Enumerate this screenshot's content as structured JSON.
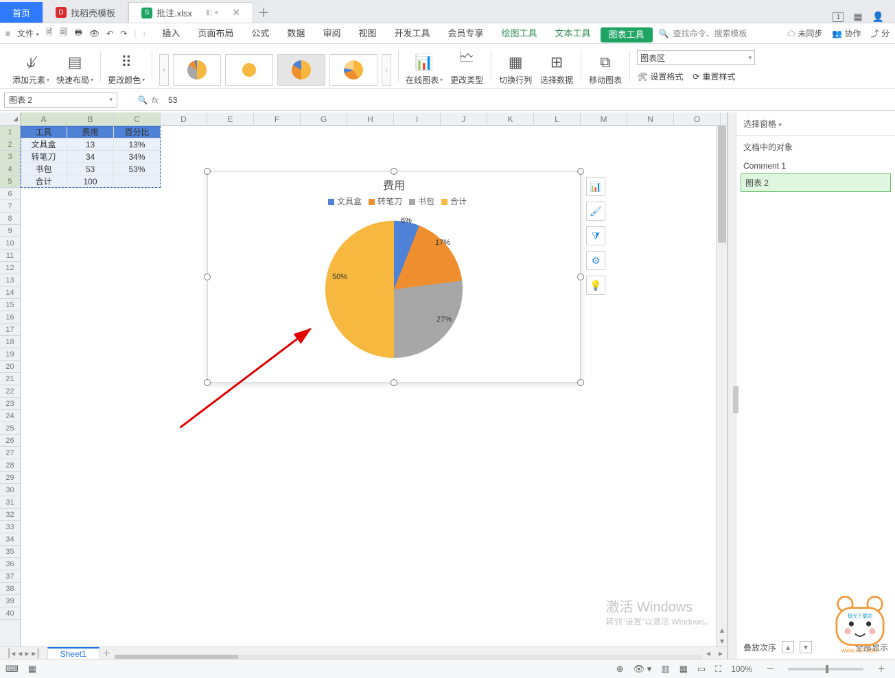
{
  "tabs": {
    "home": "首页",
    "docai": "找稻壳模板",
    "file": "批注.xlsx"
  },
  "titlebar_right": {
    "badge": "1"
  },
  "ribbon": {
    "file_menu": "文件",
    "insert": "插入",
    "page_layout": "页面布局",
    "formula": "公式",
    "data": "数据",
    "review": "审阅",
    "view": "视图",
    "dev": "开发工具",
    "vip": "会员专享",
    "draw": "绘图工具",
    "text": "文本工具",
    "chart": "图表工具",
    "search_placeholder": "查找命令、搜索模板",
    "unsync": "未同步",
    "coop": "协作",
    "share": "分"
  },
  "tools": {
    "add_element": "添加元素",
    "quick_layout": "快速布局",
    "change_color": "更改颜色",
    "online_chart": "在线图表",
    "change_type": "更改类型",
    "switch_rc": "切换行列",
    "select_data": "选择数据",
    "move_chart": "移动图表",
    "area_combo": "图表区",
    "set_fmt": "设置格式",
    "reset_style": "重置样式"
  },
  "fx": {
    "name_box": "图表 2",
    "formula": "53"
  },
  "table": {
    "headers": [
      "工具",
      "费用",
      "百分比"
    ],
    "rows": [
      {
        "a": "文具盒",
        "b": "13",
        "c": "13%"
      },
      {
        "a": "转笔刀",
        "b": "34",
        "c": "34%"
      },
      {
        "a": "书包",
        "b": "53",
        "c": "53%"
      },
      {
        "a": "合计",
        "b": "100",
        "c": ""
      }
    ]
  },
  "chart_data": {
    "type": "pie",
    "title": "费用",
    "legend": [
      "文具盒",
      "转笔刀",
      "书包",
      "合计"
    ],
    "categories": [
      "文具盒",
      "转笔刀",
      "书包",
      "合计"
    ],
    "values": [
      6,
      17,
      27,
      50
    ],
    "value_suffix": "%",
    "colors": {
      "文具盒": "#4f81d6",
      "转笔刀": "#ef8e2f",
      "书包": "#a7a7a7",
      "合计": "#f6b83e"
    }
  },
  "side": {
    "title": "选择窗格",
    "subtitle": "文档中的对象",
    "items": [
      "Comment 1",
      "图表 2"
    ],
    "selected_index": 1,
    "stack": "叠放次序",
    "showall": "全部显示"
  },
  "sheet": {
    "name": "Sheet1"
  },
  "status": {
    "zoom": "100%"
  },
  "watermark": {
    "line1": "激活 Windows",
    "line2": "转到\"设置\"以激活 Windows。"
  },
  "mascot_site": "www.xz7.com",
  "cols": [
    "A",
    "B",
    "C",
    "D",
    "E",
    "F",
    "G",
    "H",
    "I",
    "J",
    "K",
    "L",
    "M",
    "N",
    "O"
  ]
}
